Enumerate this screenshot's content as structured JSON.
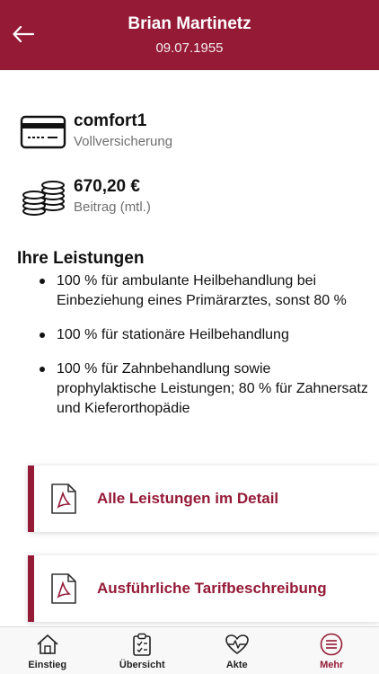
{
  "header": {
    "title": "Brian Martinetz",
    "subtitle": "09.07.1955"
  },
  "tariff": {
    "name": "comfort1",
    "type": "Vollversicherung"
  },
  "premium": {
    "amount": "670,20 €",
    "label": "Beitrag (mtl.)"
  },
  "benefits": {
    "title": "Ihre Leistungen",
    "items": [
      "100 % für ambulante Heilbehandlung bei Einbeziehung eines Primärarztes, sonst 80 %",
      "100 % für stationäre Heilbehandlung",
      "100 % für Zahnbehandlung sowie prophylaktische Leistungen; 80 % für Zahnersatz und Kieferorthopädie"
    ]
  },
  "documents": [
    {
      "label": "Alle Leistungen im Detail",
      "icon": "pdf-icon"
    },
    {
      "label": "Ausführliche Tarifbeschreibung",
      "icon": "pdf-icon"
    }
  ],
  "tabs": [
    {
      "label": "Einstieg",
      "icon": "home-icon",
      "active": false
    },
    {
      "label": "Übersicht",
      "icon": "clipboard-icon",
      "active": false
    },
    {
      "label": "Akte",
      "icon": "heart-pulse-icon",
      "active": false
    },
    {
      "label": "Mehr",
      "icon": "menu-icon",
      "active": true
    }
  ],
  "colors": {
    "brand": "#951a36",
    "text": "#111111",
    "muted": "#6f6f6f"
  }
}
